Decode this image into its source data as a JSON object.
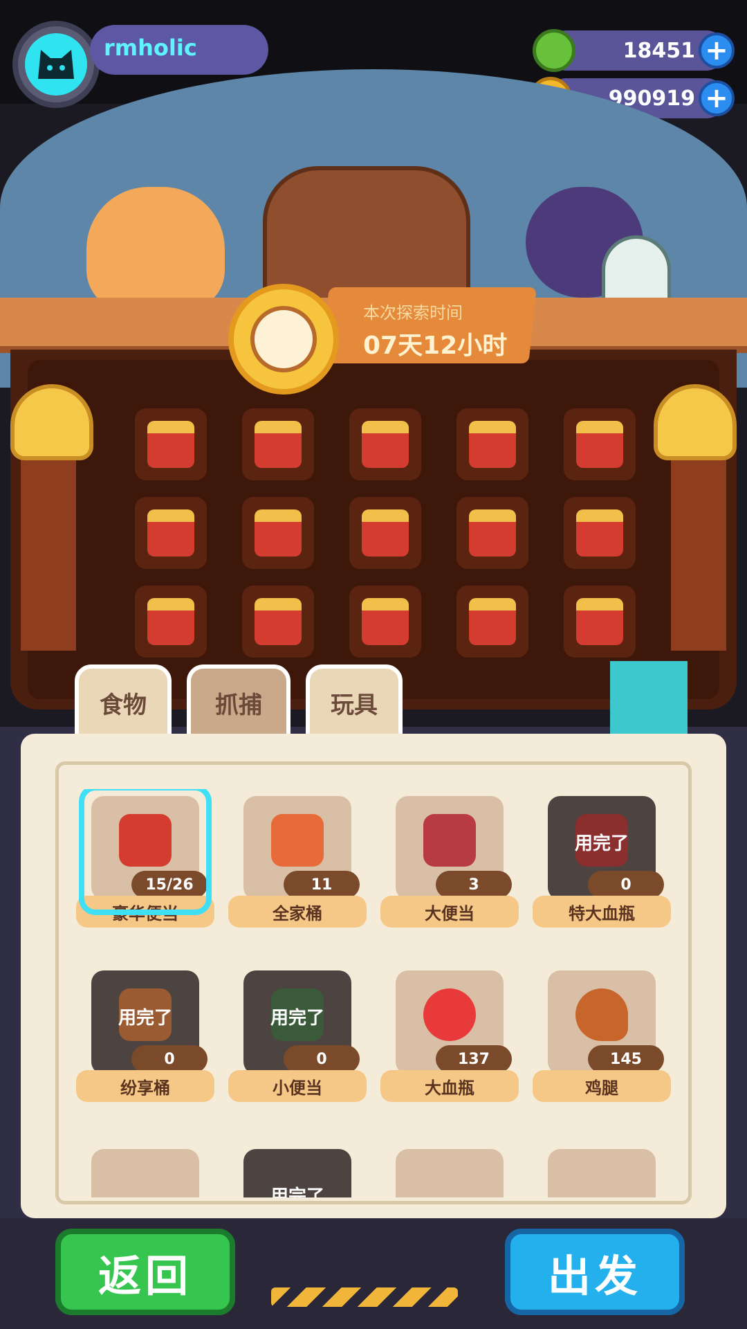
{
  "player": {
    "name": "rmholic"
  },
  "currencies": [
    {
      "name": "green-gem",
      "value": "18451",
      "color": "#67c13a"
    },
    {
      "name": "gold-coin",
      "value": "990919",
      "color": "#f4b92a"
    }
  ],
  "timer": {
    "label": "本次探索时间",
    "value": "07天12小时"
  },
  "slots": {
    "rows": 3,
    "cols": 5
  },
  "tabs": [
    {
      "label": "食物",
      "active": false
    },
    {
      "label": "抓捕",
      "active": true
    },
    {
      "label": "玩具",
      "active": false
    }
  ],
  "items": [
    {
      "name": "豪华便当",
      "count": "15/26",
      "selected": true,
      "empty": false,
      "color": "#d43c2f"
    },
    {
      "name": "全家桶",
      "count": "11",
      "selected": false,
      "empty": false,
      "color": "#e76a3a"
    },
    {
      "name": "大便当",
      "count": "3",
      "selected": false,
      "empty": false,
      "color": "#b83a42"
    },
    {
      "name": "特大血瓶",
      "count": "0",
      "selected": false,
      "empty": true,
      "empty_label": "用完了",
      "color": "#8a2e2e"
    },
    {
      "name": "纷享桶",
      "count": "0",
      "selected": false,
      "empty": true,
      "empty_label": "用完了",
      "color": "#9a5a32"
    },
    {
      "name": "小便当",
      "count": "0",
      "selected": false,
      "empty": true,
      "empty_label": "用完了",
      "color": "#3a5a3a"
    },
    {
      "name": "大血瓶",
      "count": "137",
      "selected": false,
      "empty": false,
      "color": "#e83a3a"
    },
    {
      "name": "鸡腿",
      "count": "145",
      "selected": false,
      "empty": false,
      "color": "#c7652a"
    }
  ],
  "partial_row": {
    "empty_label": "用完了"
  },
  "buttons": {
    "back": "返回",
    "go": "出发"
  }
}
